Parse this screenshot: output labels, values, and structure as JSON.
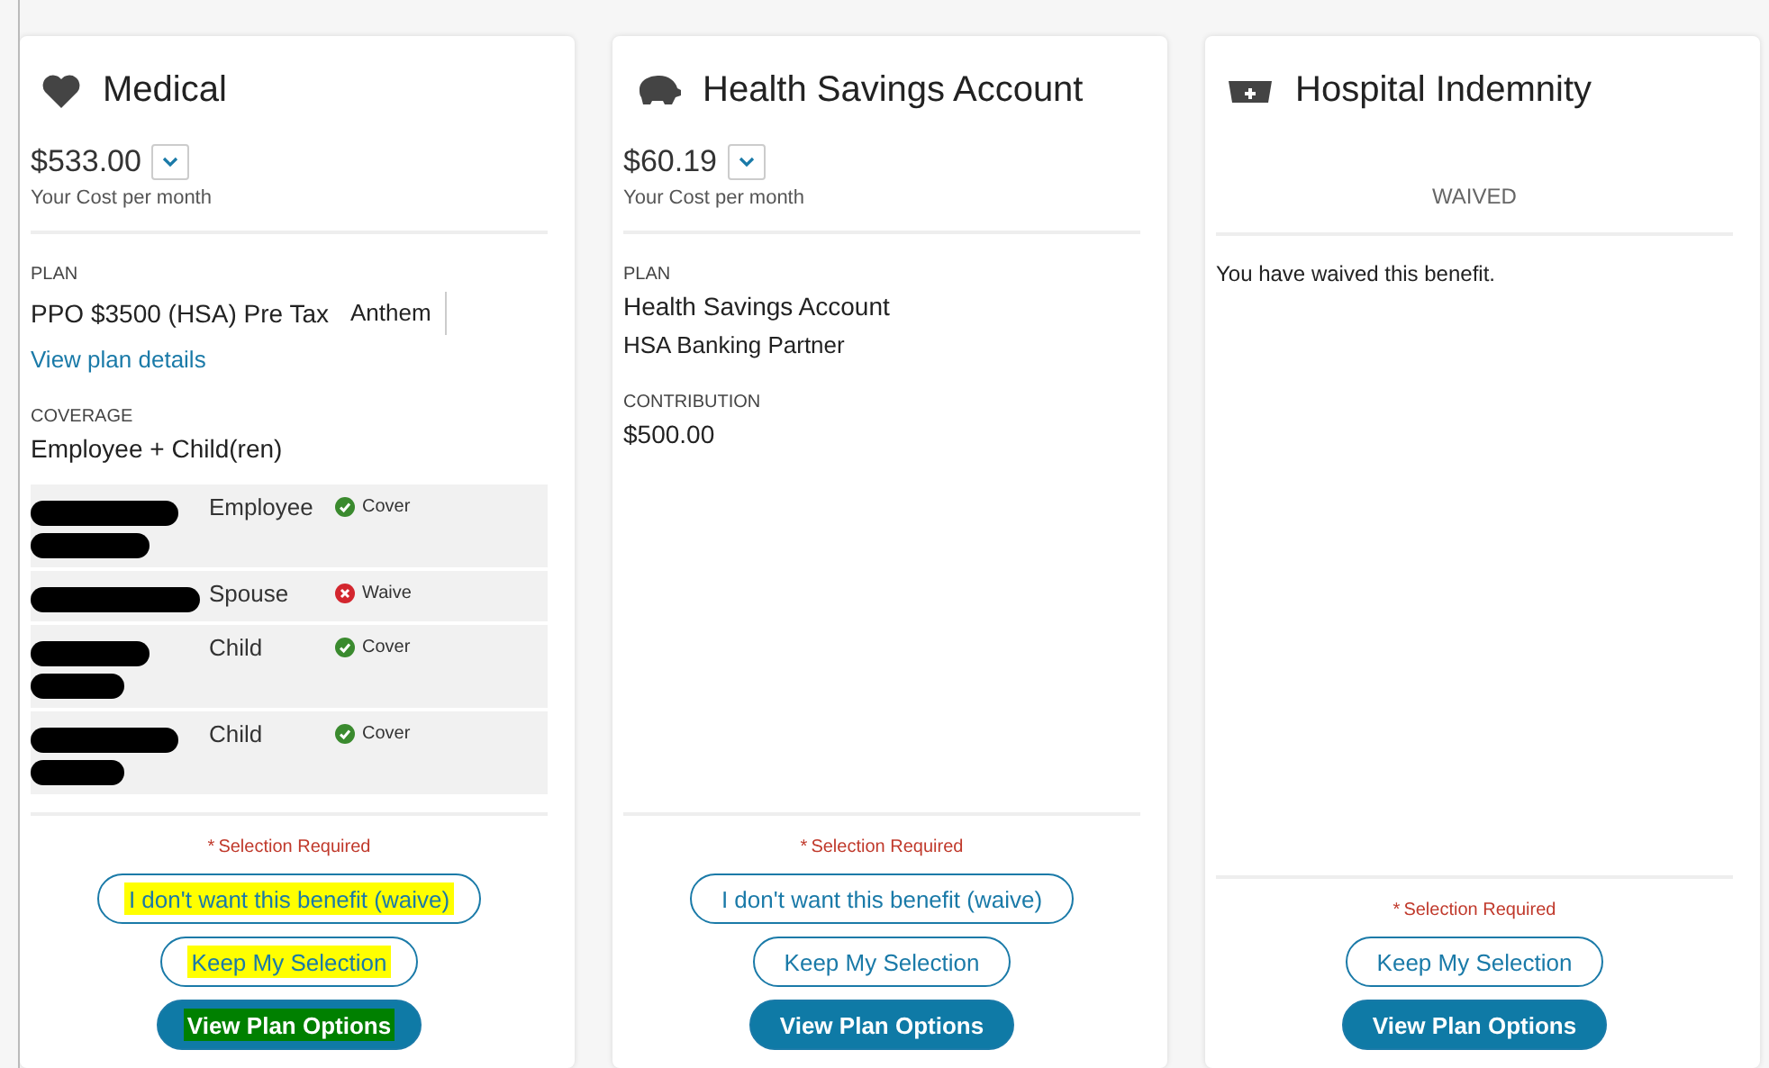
{
  "cards": [
    {
      "kind": "medical",
      "title": "Medical",
      "price": "$533.00",
      "price_caption": "Your Cost per month",
      "sections": [
        {
          "label": "PLAN",
          "value": "PPO $3500 (HSA) Pre Tax",
          "extra": "Anthem",
          "link": "View plan details"
        },
        {
          "label": "COVERAGE",
          "value": "Employee + Child(ren)"
        }
      ],
      "dependents": [
        {
          "relationship": "Employee",
          "status": "Cover",
          "covered": true
        },
        {
          "relationship": "Spouse",
          "status": "Waive",
          "covered": false
        },
        {
          "relationship": "Child",
          "status": "Cover",
          "covered": true
        },
        {
          "relationship": "Child",
          "status": "Cover",
          "covered": true
        }
      ],
      "required_mark": "*",
      "required": "Selection Required",
      "buttons": [
        {
          "label": "I don't want this benefit (waive)",
          "kind": "outline",
          "highlighted": true
        },
        {
          "label": "Keep My Selection",
          "kind": "outline",
          "highlighted": true
        },
        {
          "label": "View Plan Options",
          "kind": "solid",
          "highlighted": true
        }
      ]
    },
    {
      "kind": "hsa",
      "title": "Health Savings Account",
      "price": "$60.19",
      "price_caption": "Your Cost per month",
      "sections": [
        {
          "label": "PLAN",
          "value": "Health Savings Account",
          "extra_line": "HSA Banking Partner"
        },
        {
          "label": "CONTRIBUTION",
          "value": "$500.00"
        }
      ],
      "required_mark": "*",
      "required": "Selection Required",
      "buttons": [
        {
          "label": "I don't want this benefit (waive)",
          "kind": "outline",
          "highlighted": false
        },
        {
          "label": "Keep My Selection",
          "kind": "outline",
          "highlighted": false
        },
        {
          "label": "View Plan Options",
          "kind": "solid",
          "highlighted": false
        }
      ]
    },
    {
      "kind": "waived",
      "title": "Hospital Indemnity",
      "status": "WAIVED",
      "message": "You have waived this benefit.",
      "required_mark": "*",
      "required": "Selection Required",
      "buttons": [
        {
          "label": "Keep My Selection",
          "kind": "outline",
          "highlighted": false
        },
        {
          "label": "View Plan Options",
          "kind": "solid",
          "highlighted": false
        }
      ]
    }
  ]
}
